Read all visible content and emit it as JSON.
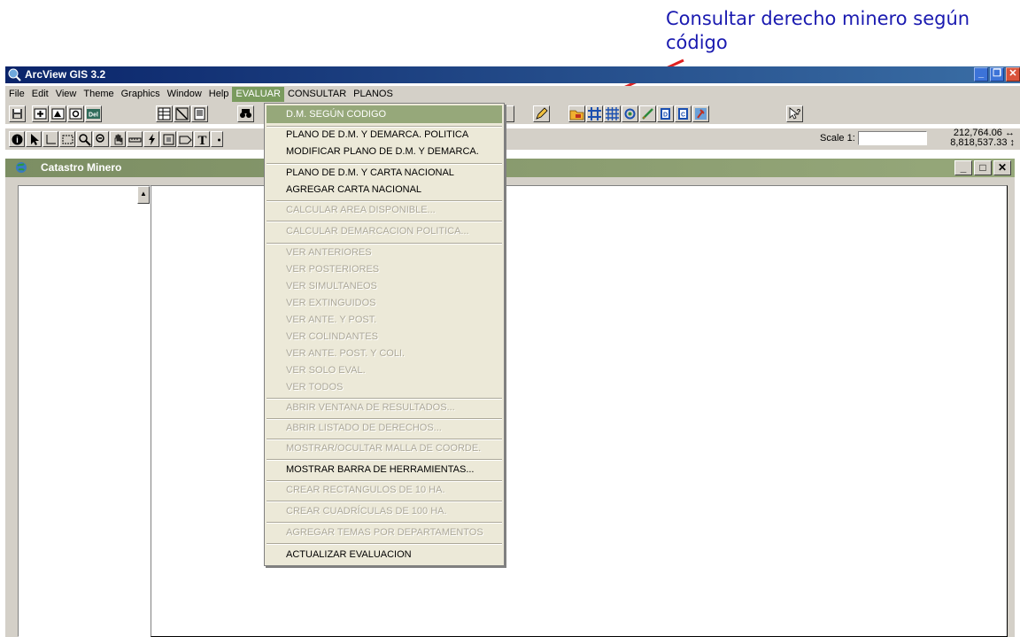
{
  "annotation": {
    "lines": [
      "Consultar derecho minero según",
      "código"
    ]
  },
  "app": {
    "title": "ArcView GIS 3.2"
  },
  "menubar": {
    "items": [
      {
        "label": "File"
      },
      {
        "label": "Edit"
      },
      {
        "label": "View"
      },
      {
        "label": "Theme"
      },
      {
        "label": "Graphics"
      },
      {
        "label": "Window"
      },
      {
        "label": "Help"
      },
      {
        "label": "EVALUAR"
      },
      {
        "label": "CONSULTAR"
      },
      {
        "label": "PLANOS"
      }
    ]
  },
  "toolbar": {
    "scale_label": "Scale 1:",
    "scale_value": "",
    "coord_x": "212,764.06",
    "coord_y": "8,818,537.33"
  },
  "view": {
    "title": "Catastro Minero"
  },
  "dropdown": {
    "items": [
      {
        "label": "D.M. SEGÚN CODIGO",
        "state": "selected"
      },
      {
        "label": "PLANO DE D.M. Y DEMARCA. POLITICA",
        "state": "enabled"
      },
      {
        "label": "MODIFICAR PLANO DE D.M. Y DEMARCA.",
        "state": "enabled"
      },
      {
        "label": "PLANO DE D.M. Y CARTA NACIONAL",
        "state": "enabled"
      },
      {
        "label": "AGREGAR CARTA NACIONAL",
        "state": "enabled"
      },
      {
        "label": "CALCULAR AREA DISPONIBLE...",
        "state": "disabled"
      },
      {
        "label": "CALCULAR DEMARCACION POLITICA...",
        "state": "disabled"
      },
      {
        "label": "VER ANTERIORES",
        "state": "disabled"
      },
      {
        "label": "VER POSTERIORES",
        "state": "disabled"
      },
      {
        "label": "VER SIMULTANEOS",
        "state": "disabled"
      },
      {
        "label": "VER EXTINGUIDOS",
        "state": "disabled"
      },
      {
        "label": "VER ANTE. Y POST.",
        "state": "disabled"
      },
      {
        "label": "VER COLINDANTES",
        "state": "disabled"
      },
      {
        "label": "VER ANTE. POST. Y COLI.",
        "state": "disabled"
      },
      {
        "label": "VER SOLO EVAL.",
        "state": "disabled"
      },
      {
        "label": "VER TODOS",
        "state": "disabled"
      },
      {
        "label": "ABRIR VENTANA DE RESULTADOS...",
        "state": "disabled"
      },
      {
        "label": "ABRIR LISTADO DE DERECHOS...",
        "state": "disabled"
      },
      {
        "label": "MOSTRAR/OCULTAR MALLA DE COORDE.",
        "state": "disabled"
      },
      {
        "label": "MOSTRAR BARRA DE HERRAMIENTAS...",
        "state": "enabled"
      },
      {
        "label": "CREAR RECTANGULOS DE 10 HA.",
        "state": "disabled"
      },
      {
        "label": "CREAR CUADRÍCULAS DE 100 HA.",
        "state": "disabled"
      },
      {
        "label": "AGREGAR TEMAS POR DEPARTAMENTOS",
        "state": "disabled"
      },
      {
        "label": "ACTUALIZAR EVALUACION",
        "state": "enabled"
      }
    ]
  }
}
